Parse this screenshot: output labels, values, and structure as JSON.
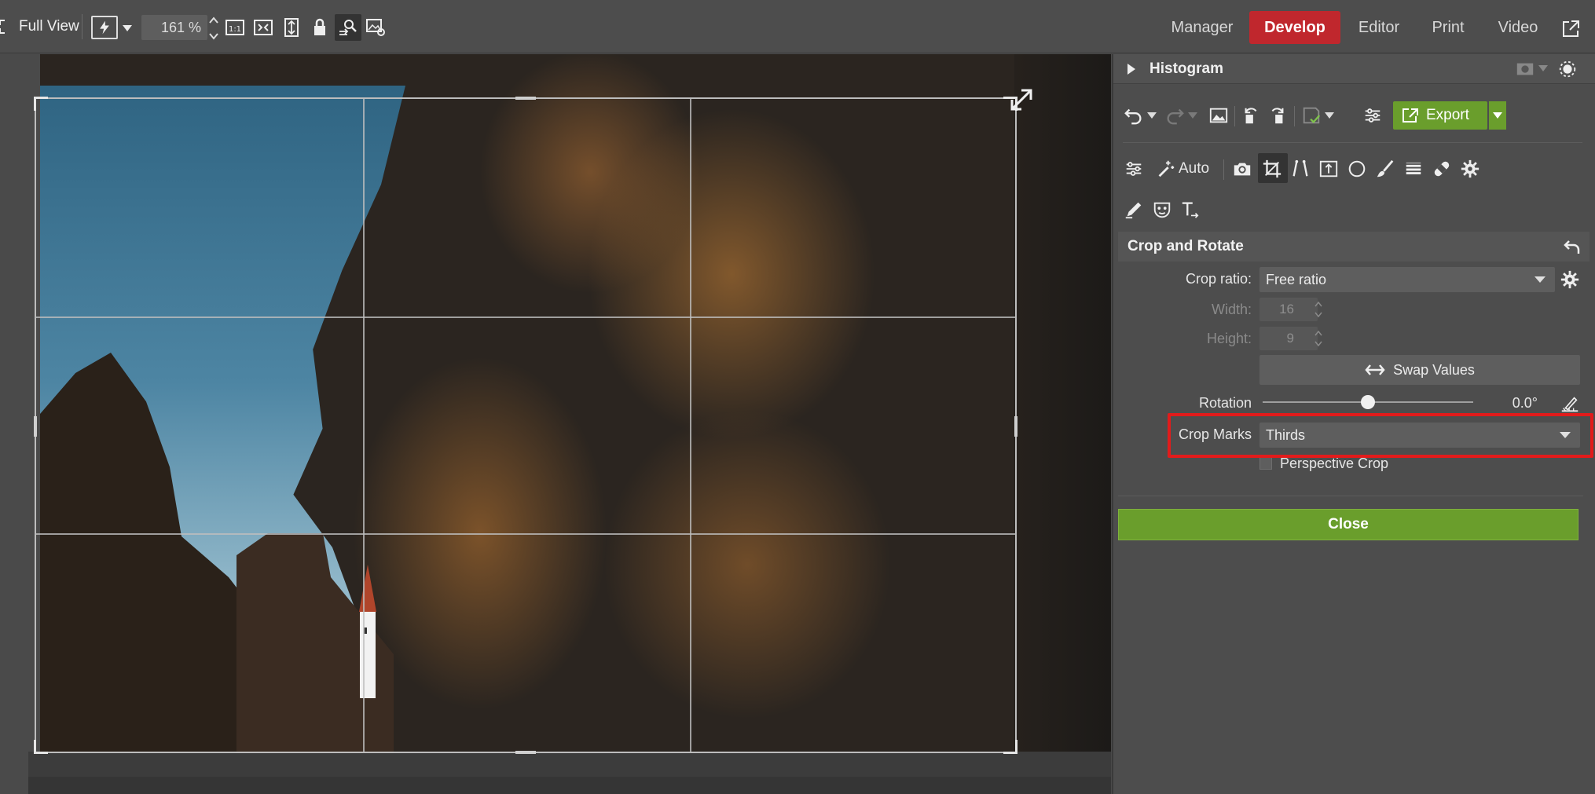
{
  "toolbar": {
    "full_view_label": "Full View",
    "zoom_value": "161 %"
  },
  "nav": {
    "manager": "Manager",
    "develop": "Develop",
    "editor": "Editor",
    "print": "Print",
    "video": "Video"
  },
  "panel": {
    "histogram_title": "Histogram",
    "export_label": "Export",
    "auto_label": "Auto",
    "section_title": "Crop and Rotate",
    "crop_ratio_label": "Crop ratio:",
    "crop_ratio_value": "Free ratio",
    "width_label": "Width:",
    "width_value": "16",
    "height_label": "Height:",
    "height_value": "9",
    "swap_label": "Swap Values",
    "rotation_label": "Rotation",
    "rotation_value": "0.0°",
    "rotation_fraction": 0.5,
    "crop_marks_label": "Crop Marks",
    "crop_marks_value": "Thirds",
    "perspective_label": "Perspective Crop",
    "close_label": "Close"
  },
  "colors": {
    "accent_red": "#c0272d",
    "accent_green": "#6a9e2c",
    "highlight_red": "#e21b1b"
  }
}
